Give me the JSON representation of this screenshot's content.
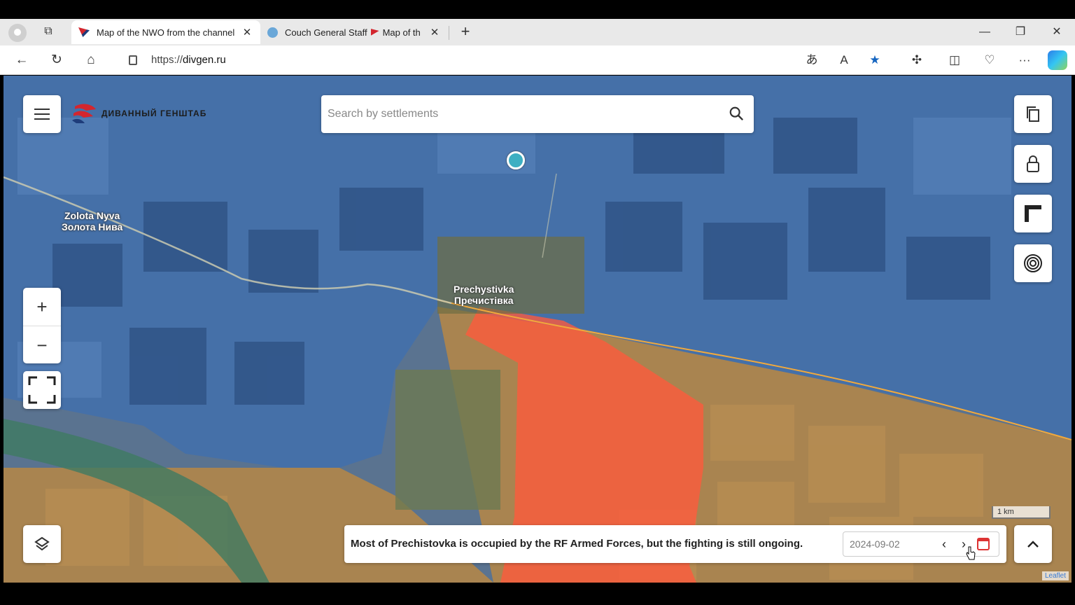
{
  "browser": {
    "tabs": [
      {
        "title": "Map of the NWO from the channel",
        "active": true
      },
      {
        "title": "Couch General Staff",
        "title_suffix": "Map of th",
        "active": false
      }
    ],
    "url_prefix": "https://",
    "url_domain": "divgen.ru",
    "new_tab": "+",
    "minimize": "—",
    "restore": "❐",
    "close": "✕"
  },
  "map": {
    "logo_text": "ДИВАННЫЙ ГЕНШТАБ",
    "search_placeholder": "Search by settlements",
    "places": [
      {
        "name": "Zolota Nyva",
        "name_local": "Золота Нива"
      },
      {
        "name": "Prechystivka",
        "name_local": "Пречистівка"
      }
    ],
    "zoom_in": "+",
    "zoom_out": "−",
    "scale_label": "1 km",
    "info_text": "Most of Prechistovka is occupied by the RF Armed Forces, but the fighting is still ongoing.",
    "date": "2024-09-02",
    "attribution": "Leaflet",
    "colors": {
      "ua_control": "#3f6fb0",
      "ru_control": "#ff5a3c",
      "contested": "#e0a64a",
      "front_line": "#f2a93b"
    },
    "icons": [
      "menu-icon",
      "search-icon",
      "copy-icon",
      "lock-icon",
      "ruler-icon",
      "target-icon",
      "layers-icon",
      "fullscreen-icon",
      "chevron-up-icon",
      "calendar-icon"
    ]
  }
}
